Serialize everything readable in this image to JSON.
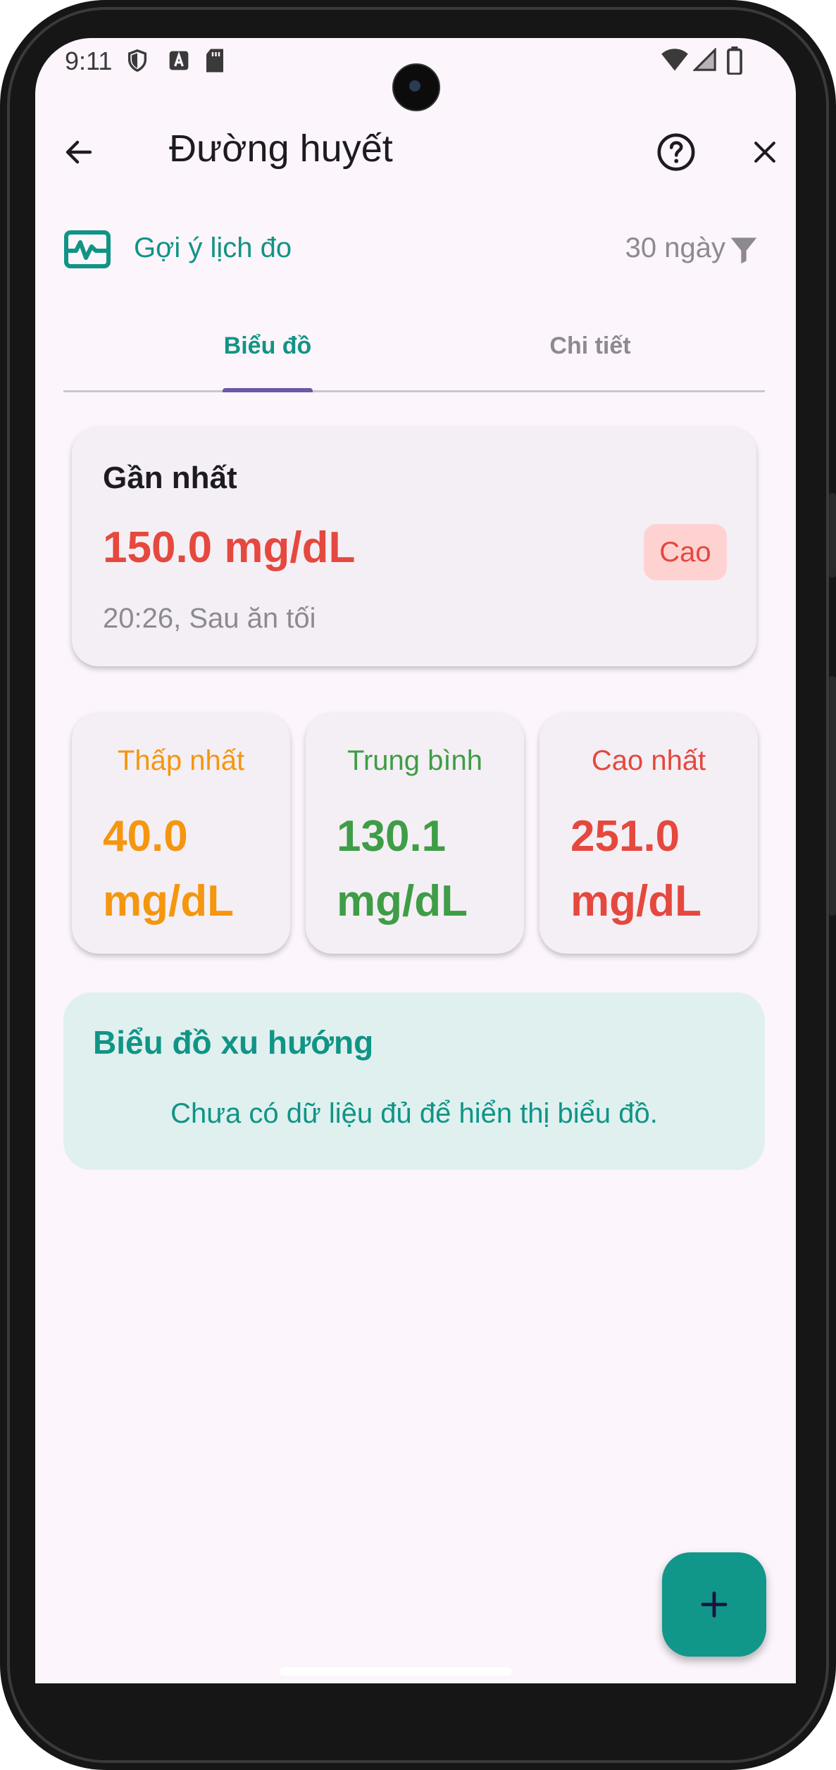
{
  "status_bar": {
    "time": "9:11"
  },
  "app_bar": {
    "title": "Đường huyết"
  },
  "schedule": {
    "label": "Gợi ý lịch đo",
    "range": "30 ngày"
  },
  "tabs": [
    {
      "label": "Biểu đồ",
      "selected": true
    },
    {
      "label": "Chi tiết",
      "selected": false
    }
  ],
  "latest": {
    "title": "Gần nhất",
    "value": "150.0 mg/dL",
    "badge": "Cao",
    "meta": "20:26, Sau ăn tối"
  },
  "stats": [
    {
      "label": "Thấp nhất",
      "value": "40.0",
      "unit": "mg/dL",
      "color": "#f5960f"
    },
    {
      "label": "Trung bình",
      "value": "130.1",
      "unit": "mg/dL",
      "color": "#3e9d46"
    },
    {
      "label": "Cao nhất",
      "value": "251.0",
      "unit": "mg/dL",
      "color": "#e5483e"
    }
  ],
  "trend": {
    "title": "Biểu đồ xu hướng",
    "message": "Chưa có dữ liệu đủ để hiển thị biểu đồ."
  },
  "colors": {
    "accent": "#109486",
    "high": "#e5483e",
    "low": "#f5960f",
    "normal": "#3e9d46",
    "tab_indicator": "#6e55a6"
  },
  "icons": [
    "back-arrow-icon",
    "help-icon",
    "close-icon",
    "monitor-heart-icon",
    "filter-icon",
    "add-icon"
  ]
}
